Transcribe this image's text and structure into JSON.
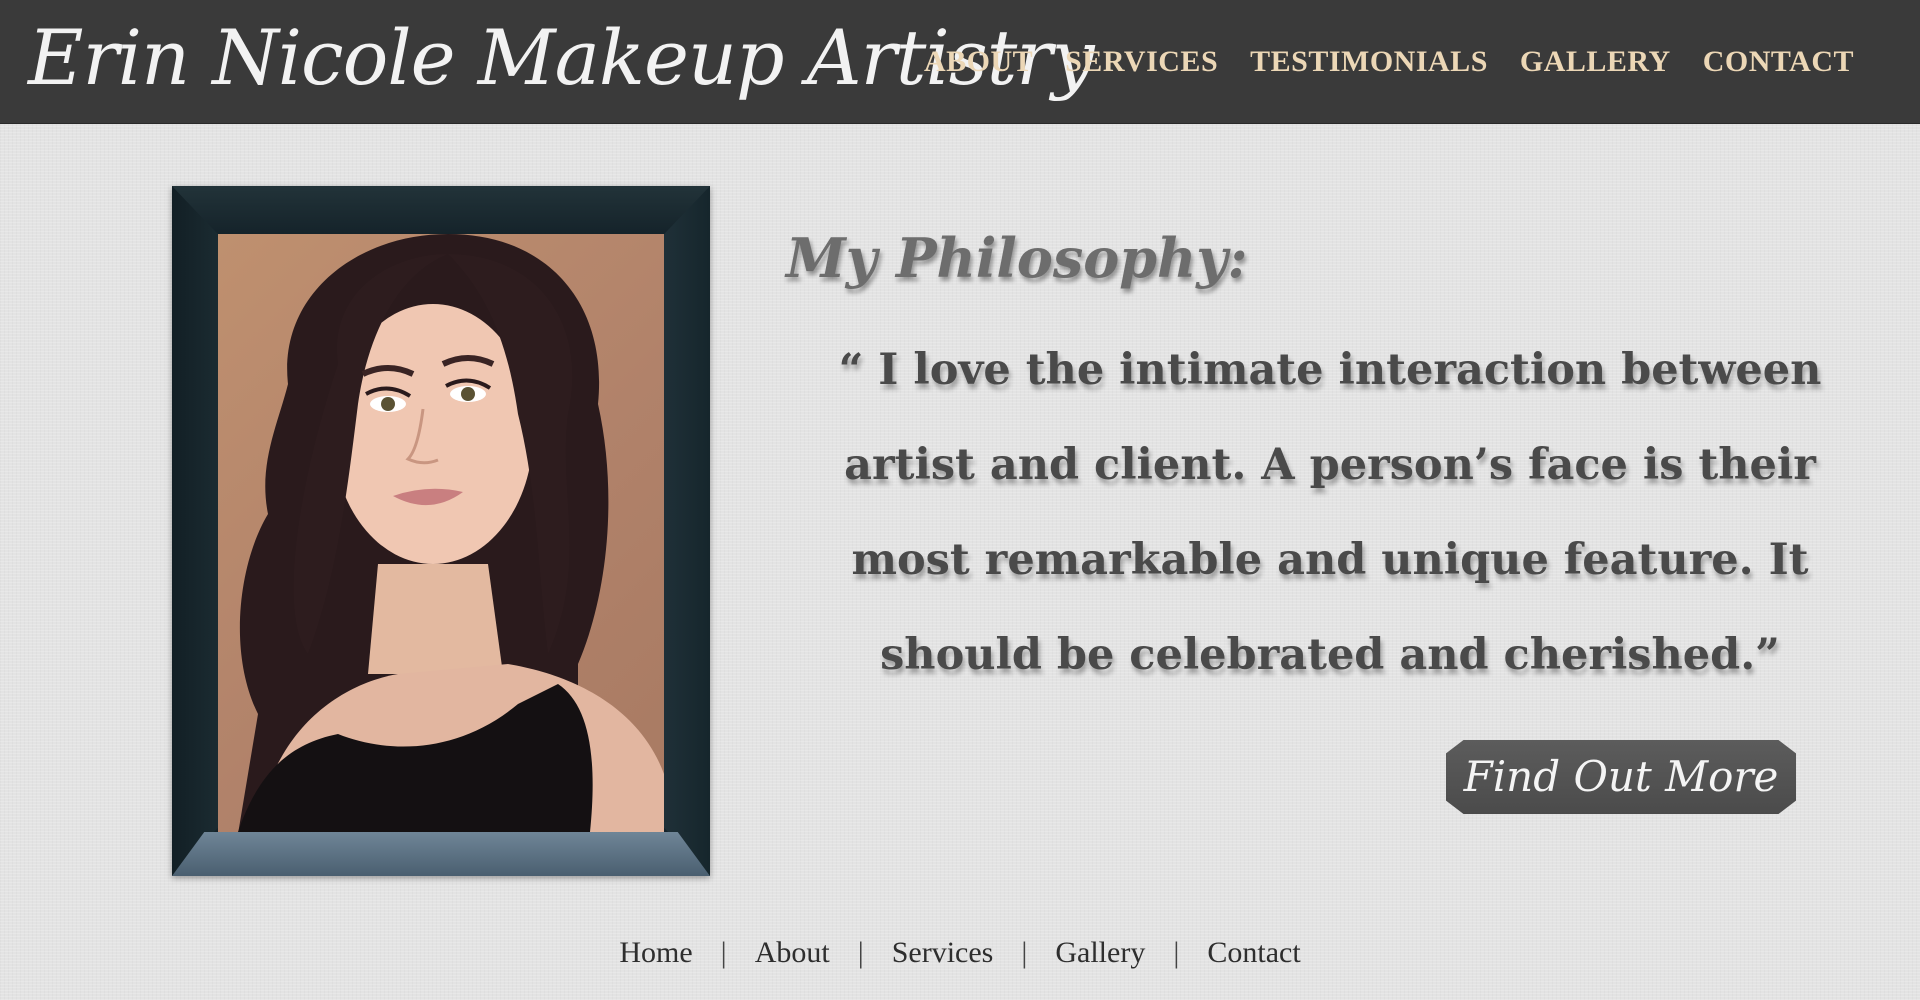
{
  "header": {
    "site_title": "Erin Nicole Makeup Artistry",
    "nav": [
      "ABOUT",
      "SERVICES",
      "TESTIMONIALS",
      "GALLERY",
      "CONTACT"
    ],
    "background_color": "#3a3a3a",
    "nav_color": "#ecd7b6"
  },
  "main": {
    "heading": "My Philosophy:",
    "quote_lines": [
      "“ I love the intimate interaction between",
      "artist and client. A person’s face is their",
      "most remarkable and unique feature. It",
      "should be celebrated and cherished.”"
    ],
    "cta_label": "Find Out More"
  },
  "footer": {
    "nav": [
      "Home",
      "About",
      "Services",
      "Gallery",
      "Contact"
    ],
    "separator": "|"
  }
}
